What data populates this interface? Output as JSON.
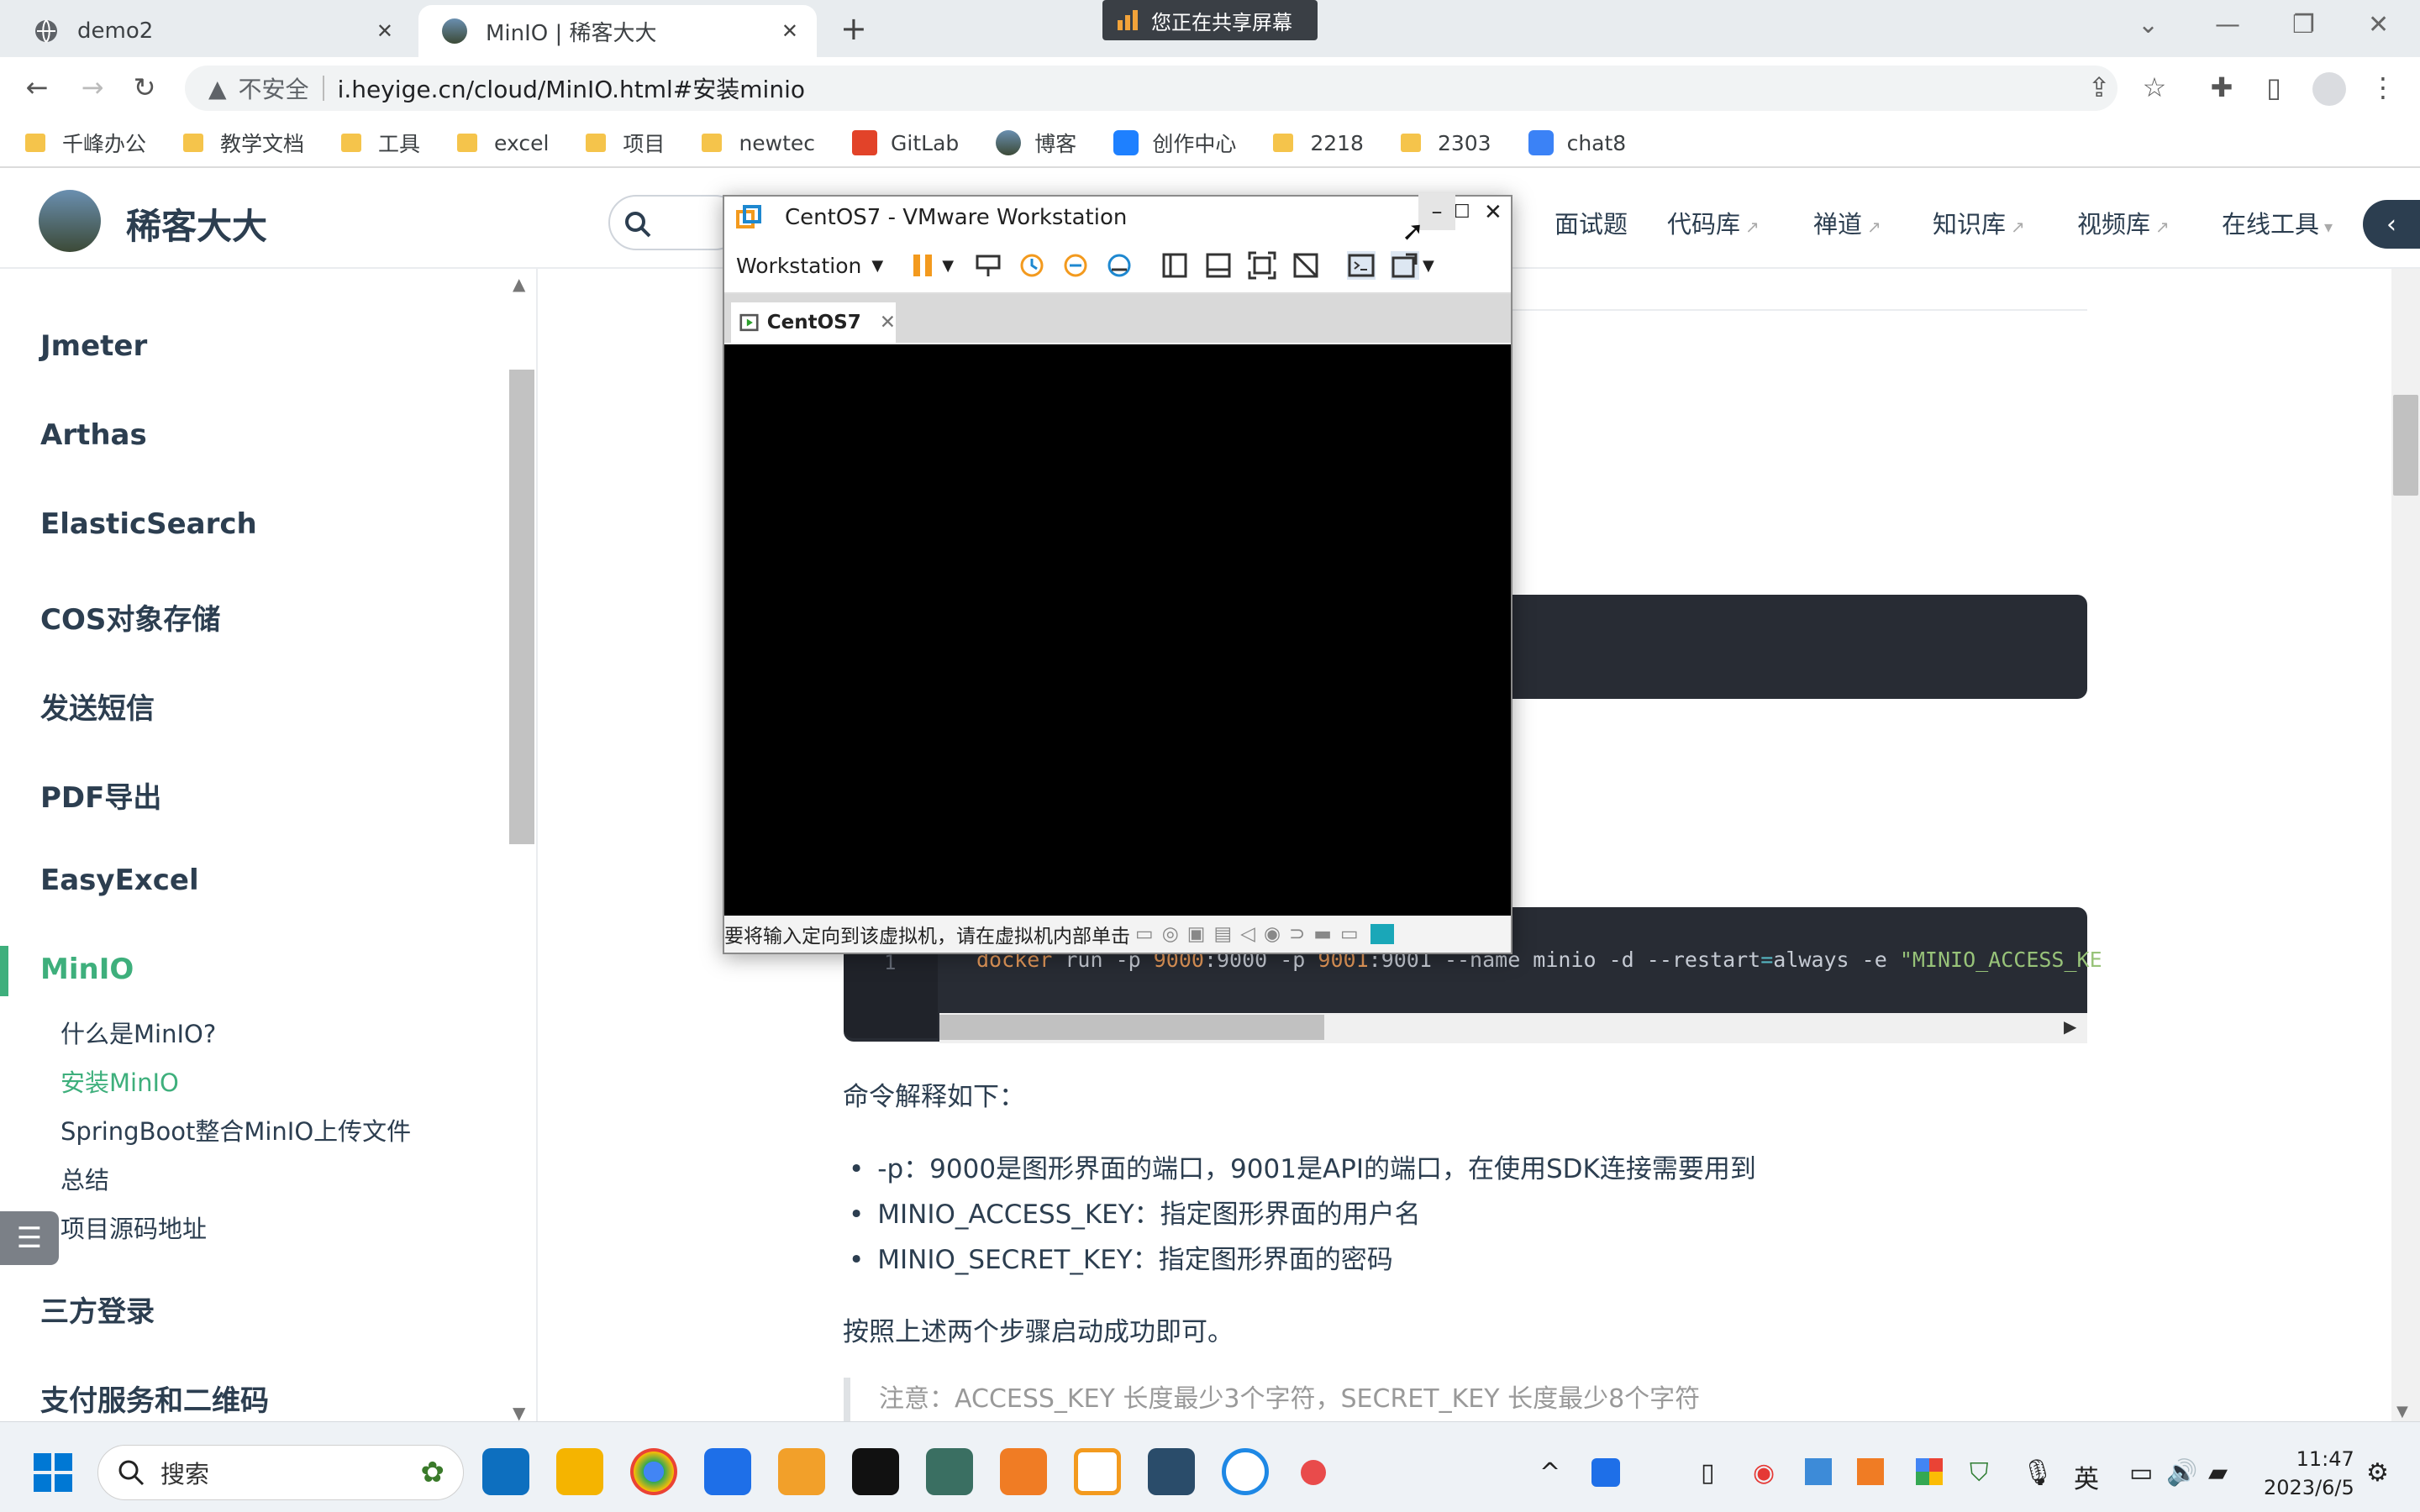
{
  "browser": {
    "tabs": [
      {
        "title": "demo2"
      },
      {
        "title": "MinIO | 稀客大大"
      }
    ],
    "share_notice": "您正在共享屏幕",
    "address": {
      "security": "不安全",
      "url": "i.heyige.cn/cloud/MinIO.html#安装minio"
    },
    "bookmarks": [
      "千峰办公",
      "教学文档",
      "工具",
      "excel",
      "项目",
      "newtec",
      "GitLab",
      "博客",
      "创作中心",
      "2218",
      "2303",
      "chat8"
    ]
  },
  "site": {
    "name": "稀客大大",
    "nav": [
      "面试题",
      "代码库",
      "禅道",
      "知识库",
      "视频库",
      "在线工具"
    ]
  },
  "sidebar": {
    "sections": [
      "Jmeter",
      "Arthas",
      "ElasticSearch",
      "COS对象存储",
      "发送短信",
      "PDF导出",
      "EasyExcel",
      "MinIO",
      "三方登录",
      "支付服务和二维码"
    ],
    "subitems": [
      "什么是MinIO?",
      "安装MinIO",
      "SpringBoot整合MinIO上传文件",
      "总结",
      "项目源码地址"
    ],
    "active_sub": "安装MinIO"
  },
  "content": {
    "line_number": "1",
    "code": {
      "cmd": "docker",
      "t1": " run -p ",
      "n1": "9000",
      "t2": ":9000 -p ",
      "n2": "9001",
      "t3": ":9001 --name minio -d --restart",
      "eq": "=",
      "t4": "always -e ",
      "str": "\"MINIO_ACCESS_KE"
    },
    "explain_title": "命令解释如下：",
    "bullets": [
      "-p：9000是图形界面的端口，9001是API的端口，在使用SDK连接需要用到",
      "MINIO_ACCESS_KEY：指定图形界面的用户名",
      "MINIO_SECRET_KEY：指定图形界面的密码"
    ],
    "after": "按照上述两个步骤启动成功即可。",
    "note": "注意：ACCESS_KEY 长度最少3个字符，SECRET_KEY 长度最少8个字符"
  },
  "vmware": {
    "title": "CentOS7 - VMware Workstation",
    "menu": "Workstation",
    "tab": "CentOS7",
    "status": "要将输入定向到该虚拟机，请在虚拟机内部单击"
  },
  "taskbar": {
    "search_placeholder": "搜索",
    "ime": "英",
    "time": "11:47",
    "date": "2023/6/5"
  },
  "colors": {
    "accent": "#3eaf7c",
    "code_bg": "#282c34",
    "code_keyword": "#e5995a",
    "code_string": "#98c379"
  }
}
